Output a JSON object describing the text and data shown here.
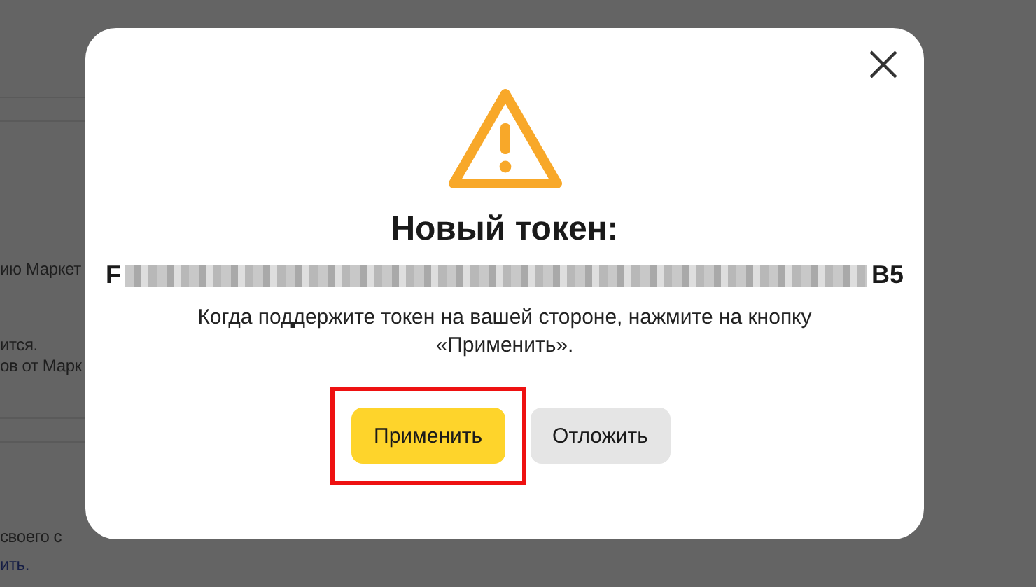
{
  "background_page": {
    "fragments": [
      {
        "text": "ию Маркет",
        "kind": "text"
      },
      {
        "text": "ится.",
        "kind": "text"
      },
      {
        "text": "ов от Марк",
        "kind": "text"
      },
      {
        "text": "своего с",
        "kind": "text"
      },
      {
        "text": "ить.",
        "kind": "link"
      }
    ]
  },
  "dialog": {
    "title": "Новый токен:",
    "token": {
      "start": "F",
      "end": "B5",
      "redacted": true
    },
    "message": "Когда поддержите токен на вашей стороне, нажмите на кнопку «Применить».",
    "buttons": [
      {
        "label": "Применить",
        "kind": "primary",
        "highlighted": true
      },
      {
        "label": "Отложить",
        "kind": "secondary",
        "highlighted": false
      }
    ]
  }
}
